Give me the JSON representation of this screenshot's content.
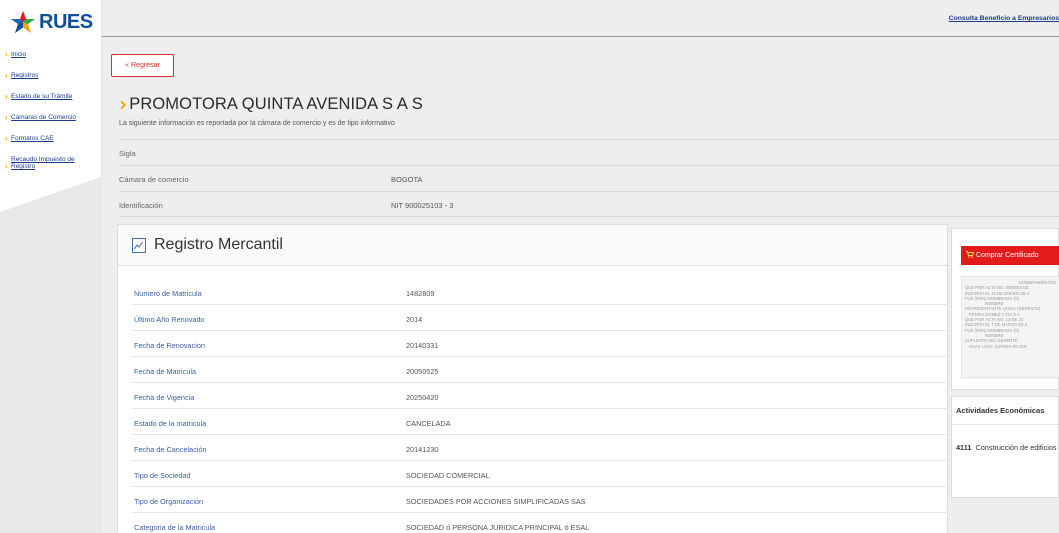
{
  "logo": {
    "text": "RUES"
  },
  "sidebar": {
    "items": [
      {
        "label": "Inicio"
      },
      {
        "label": "Registros"
      },
      {
        "label": "Estado de su Trámite"
      },
      {
        "label": "Cámaras de Comercio"
      },
      {
        "label": "Formatos CAE"
      },
      {
        "label": "Recaudo Impuesto de Registro"
      }
    ]
  },
  "topbar": {
    "link": "Consulta Beneficio a Empresarios"
  },
  "main": {
    "back_label": "« Regresar",
    "company_name": "PROMOTORA QUINTA AVENIDA S A S",
    "info_text": "La siguiente información es reportada por la cámara de comercio y es de tipo informativo",
    "summary": [
      {
        "label": "Sigla",
        "value": ""
      },
      {
        "label": "Cámara de comercio",
        "value": "BOGOTA"
      },
      {
        "label": "Identificación",
        "value": "NIT 900025103 - 3"
      }
    ]
  },
  "registro": {
    "title": "Registro Mercantil",
    "rows": [
      {
        "label": "Numero de Matricula",
        "value": "1482809"
      },
      {
        "label": "Último Año Renovado",
        "value": "2014"
      },
      {
        "label": "Fecha de Renovacion",
        "value": "20140331"
      },
      {
        "label": "Fecha de Matricula",
        "value": "20050525"
      },
      {
        "label": "Fecha de Vigencia",
        "value": "20250420"
      },
      {
        "label": "Estado de la matricula",
        "value": "CANCELADA"
      },
      {
        "label": "Fecha de Cancelación",
        "value": "20141230"
      },
      {
        "label": "Tipo de Sociedad",
        "value": "SOCIEDAD COMERCIAL"
      },
      {
        "label": "Tipo de Organización",
        "value": "SOCIEDADES POR ACCIONES SIMPLIFICADAS SAS"
      },
      {
        "label": "Categoria de la Matricula",
        "value": "SOCIEDAD ó PERSONA JURIDICA PRINCIPAL ó ESAL"
      }
    ]
  },
  "certificado": {
    "button_label": "Comprar Certificado",
    "preview_lines": [
      "NOMBRAMIENTOS",
      "QUE POR ACTA NO. 0000003 DE",
      "INSCRITA EL 15 DE ENERO DE 2",
      "FUE (RON) NOMBRADO (S)",
      "NOMBRE",
      "REPRESENTANTE LEGAL (GERENTE)",
      "PEDRO GOMEZ Y CIA S A",
      "QUE POR ACTA NO. 13 DE JU",
      "INSCRITA EL 7 DE MARZO DE 2",
      "FUE (RON) NOMBRADO (S)",
      "NOMBRE",
      "SUPLENTE DEL GERENTE",
      "HAAS LOCK JURGEN PETER"
    ]
  },
  "actividades": {
    "title": "Actividades Económicas",
    "items": [
      {
        "code": "4111",
        "desc": "Construcción de edificios residenciales"
      }
    ]
  },
  "colors": {
    "accent": "#f5a300",
    "brand": "#0d4f9f",
    "link": "#1b3e8c",
    "danger": "#e21b1b"
  }
}
